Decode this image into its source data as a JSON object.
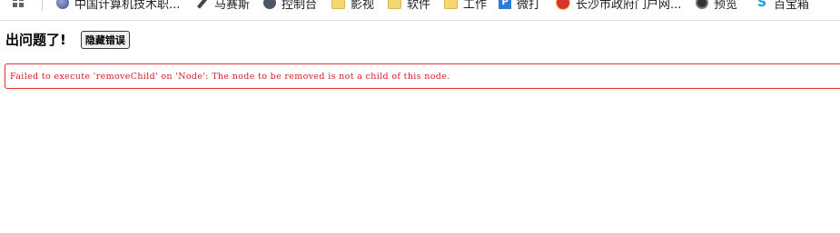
{
  "bookmarks_bar": {
    "apps_icon": "apps-grid-icon",
    "items": [
      {
        "label": "中国计算机技术职...",
        "icon": "orb-icon"
      },
      {
        "label": "马赛斯",
        "icon": "tool-icon"
      },
      {
        "label": "控制台",
        "icon": "globe-icon"
      },
      {
        "label": "影视",
        "icon": "folder-icon"
      },
      {
        "label": "软件",
        "icon": "folder-icon"
      },
      {
        "label": "工作",
        "icon": "folder-icon"
      },
      {
        "label": "微打",
        "icon": "p-logo-icon"
      },
      {
        "label": "长沙市政府门户网...",
        "icon": "emblem-icon"
      },
      {
        "label": "预览",
        "icon": "camera-icon"
      },
      {
        "label": "百宝箱",
        "icon": "s-logo-icon"
      }
    ]
  },
  "error_page": {
    "title": "出问题了!",
    "hide_button_label": "隐藏错误",
    "message": "Failed to execute 'removeChild' on 'Node': The node to be removed is not a child of this node.",
    "accent_color": "#d42020"
  }
}
